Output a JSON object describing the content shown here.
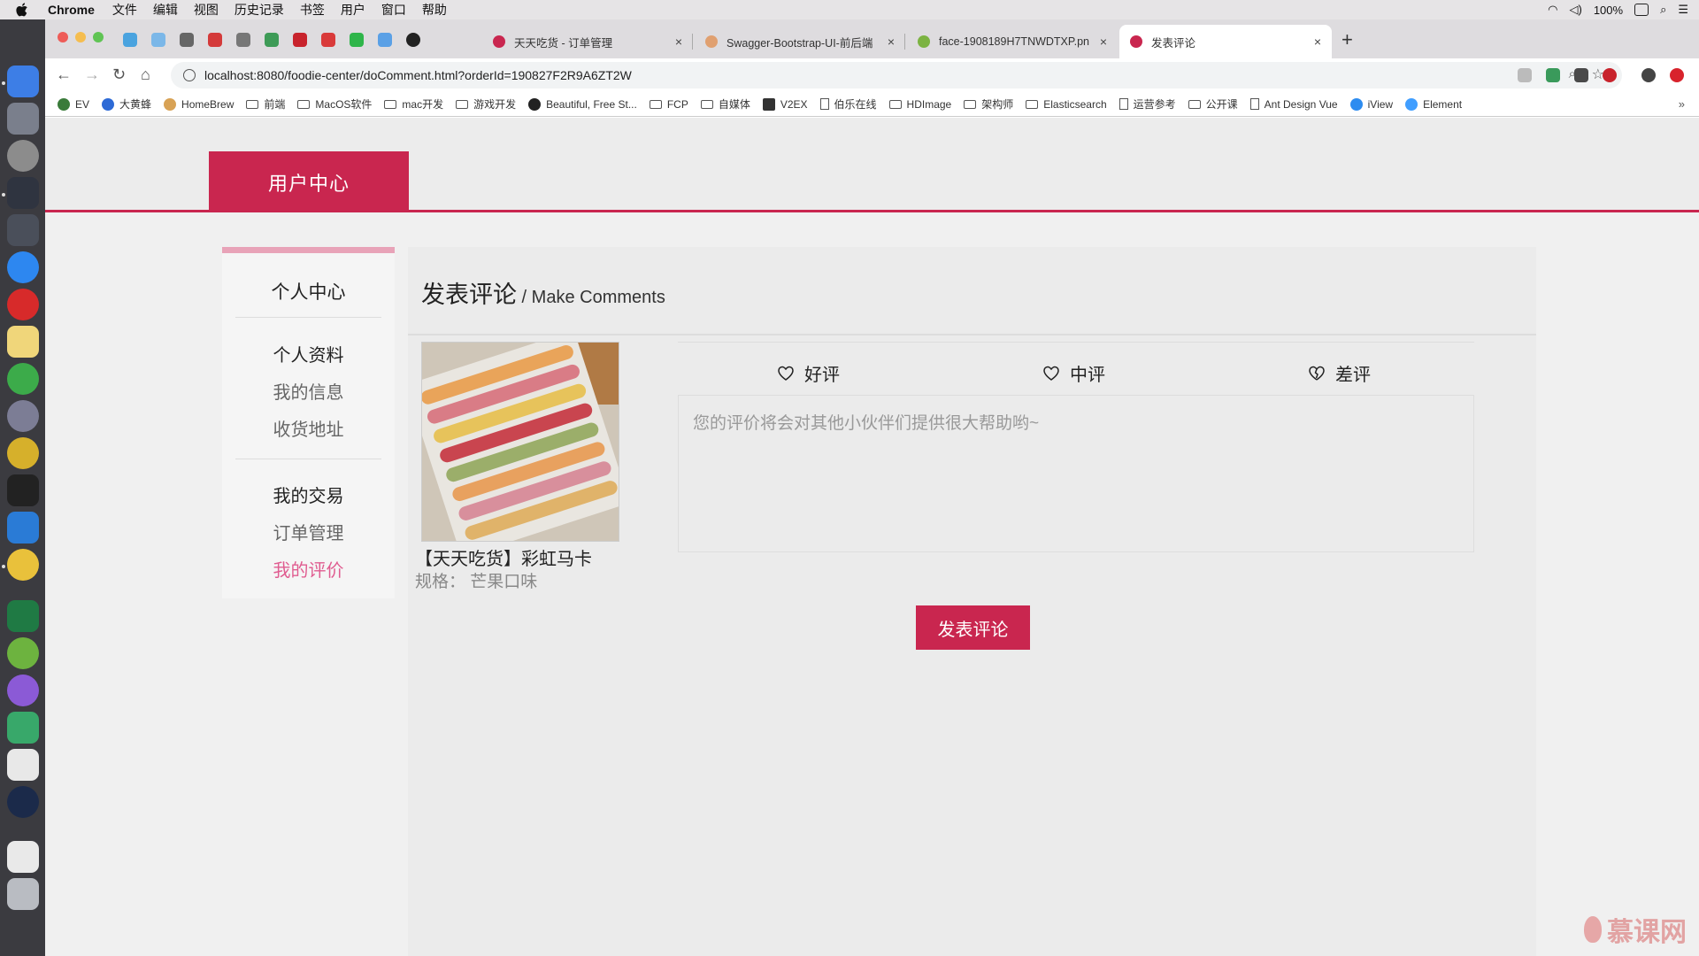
{
  "macos": {
    "menu": [
      "Chrome",
      "文件",
      "编辑",
      "视图",
      "历史记录",
      "书签",
      "用户",
      "窗口",
      "帮助"
    ],
    "battery": "100%"
  },
  "tabs": [
    {
      "title": "天天吃货 - 订单管理",
      "fav_color": "#c9264f"
    },
    {
      "title": "Swagger-Bootstrap-UI-前后端",
      "fav_color": "#e0a070"
    },
    {
      "title": "face-1908189H7TNWDTXP.pn",
      "fav_color": "#7cb342"
    },
    {
      "title": "发表评论",
      "fav_color": "#c9264f"
    }
  ],
  "url": "localhost:8080/foodie-center/doComment.html?orderId=190827F2R9A6ZT2W",
  "bookmarks": [
    {
      "label": "EV",
      "kind": "fav"
    },
    {
      "label": "大黄蜂",
      "kind": "fav"
    },
    {
      "label": "HomeBrew",
      "kind": "fav"
    },
    {
      "label": "前端",
      "kind": "folder"
    },
    {
      "label": "MacOS软件",
      "kind": "folder"
    },
    {
      "label": "mac开发",
      "kind": "folder"
    },
    {
      "label": "游戏开发",
      "kind": "folder"
    },
    {
      "label": "Beautiful, Free St...",
      "kind": "fav"
    },
    {
      "label": "FCP",
      "kind": "folder"
    },
    {
      "label": "自媒体",
      "kind": "folder"
    },
    {
      "label": "V2EX",
      "kind": "fav"
    },
    {
      "label": "伯乐在线",
      "kind": "doc"
    },
    {
      "label": "HDImage",
      "kind": "folder"
    },
    {
      "label": "架构师",
      "kind": "folder"
    },
    {
      "label": "Elasticsearch",
      "kind": "folder"
    },
    {
      "label": "运营参考",
      "kind": "doc"
    },
    {
      "label": "公开课",
      "kind": "folder"
    },
    {
      "label": "Ant Design Vue",
      "kind": "doc"
    },
    {
      "label": "iView",
      "kind": "fav"
    },
    {
      "label": "Element",
      "kind": "fav"
    }
  ],
  "header": {
    "title": "用户中心"
  },
  "sidebar": {
    "title": "个人中心",
    "groups": [
      {
        "heading": "个人资料",
        "items": [
          "我的信息",
          "收货地址"
        ]
      },
      {
        "heading": "我的交易",
        "items": [
          "订单管理",
          "我的评价"
        ]
      }
    ]
  },
  "main": {
    "title": "发表评论",
    "subtitle": " / Make Comments",
    "product": {
      "name": "【天天吃货】彩虹马卡",
      "spec": "规格：  芒果口味"
    },
    "ratings": [
      "好评",
      "中评",
      "差评"
    ],
    "placeholder": "您的评价将会对其他小伙伴们提供很大帮助哟~",
    "submit": "发表评论"
  },
  "watermark": "慕课网"
}
